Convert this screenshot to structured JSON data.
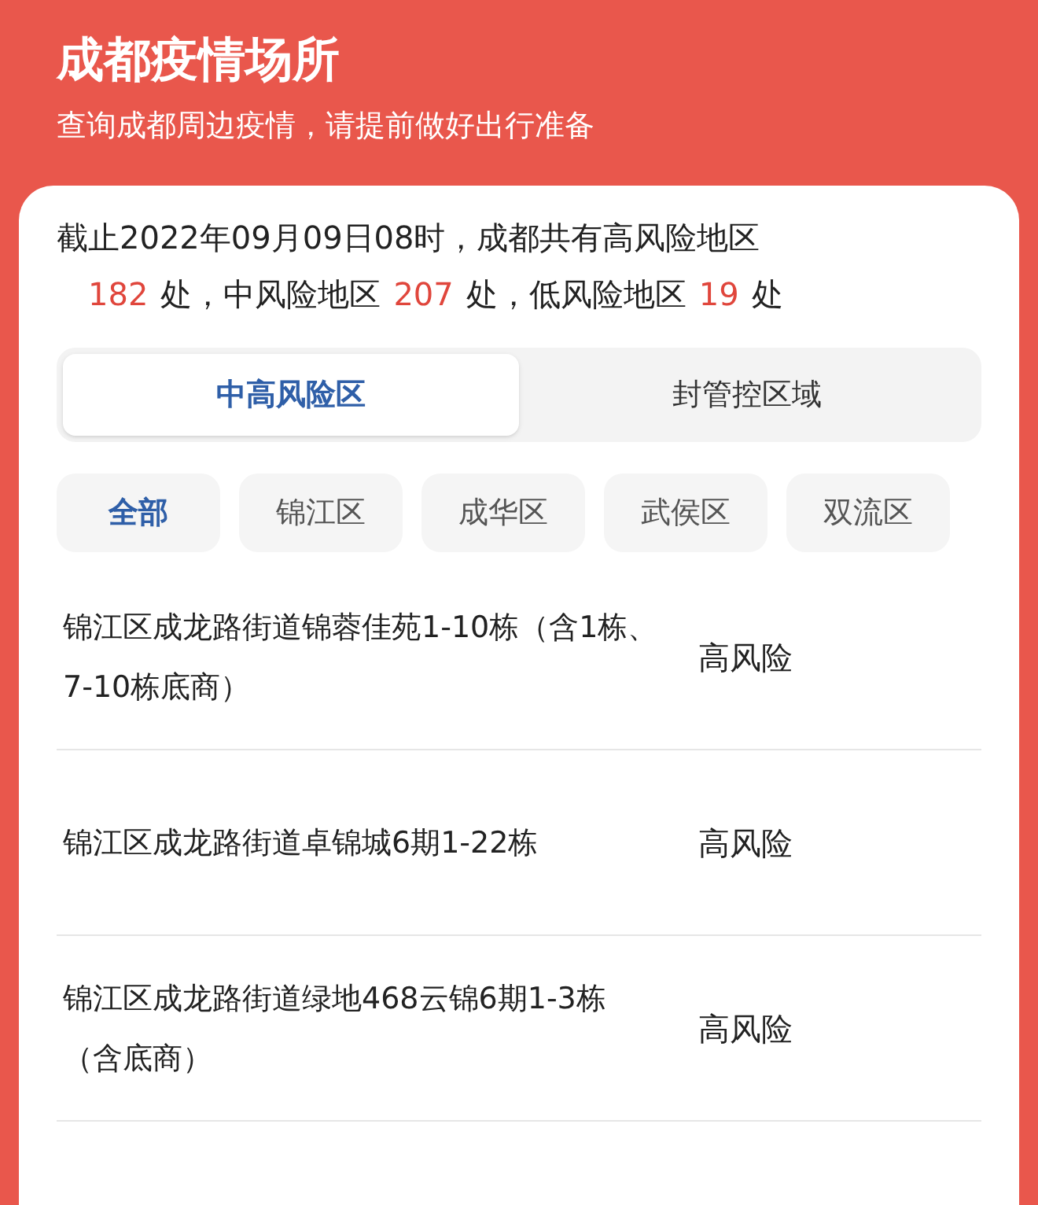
{
  "header": {
    "title": "成都疫情场所",
    "subtitle": "查询成都周边疫情，请提前做好出行准备"
  },
  "summary": {
    "line": "截止2022年09月09日08时，成都共有高风险地区",
    "segments": [
      {
        "kind": "count",
        "text": "182"
      },
      {
        "kind": "text",
        "text": "处，中风险地区"
      },
      {
        "kind": "count",
        "text": "207"
      },
      {
        "kind": "text",
        "text": "处，低风险地区"
      },
      {
        "kind": "count",
        "text": "19"
      },
      {
        "kind": "text",
        "text": "处"
      }
    ]
  },
  "tabs": [
    {
      "label": "中高风险区",
      "selected": true
    },
    {
      "label": "封管控区域",
      "selected": false
    }
  ],
  "districts": [
    {
      "label": "全部",
      "selected": true
    },
    {
      "label": "锦江区",
      "selected": false
    },
    {
      "label": "成华区",
      "selected": false
    },
    {
      "label": "武侯区",
      "selected": false
    },
    {
      "label": "双流区",
      "selected": false
    }
  ],
  "places": [
    {
      "address": "锦江区成龙路街道锦蓉佳苑1-10栋（含1栋、7-10栋底商）",
      "risk": "高风险"
    },
    {
      "address": "锦江区成龙路街道卓锦城6期1-22栋",
      "risk": "高风险"
    },
    {
      "address": "锦江区成龙路街道绿地468云锦6期1-3栋（含底商）",
      "risk": "高风险"
    }
  ]
}
